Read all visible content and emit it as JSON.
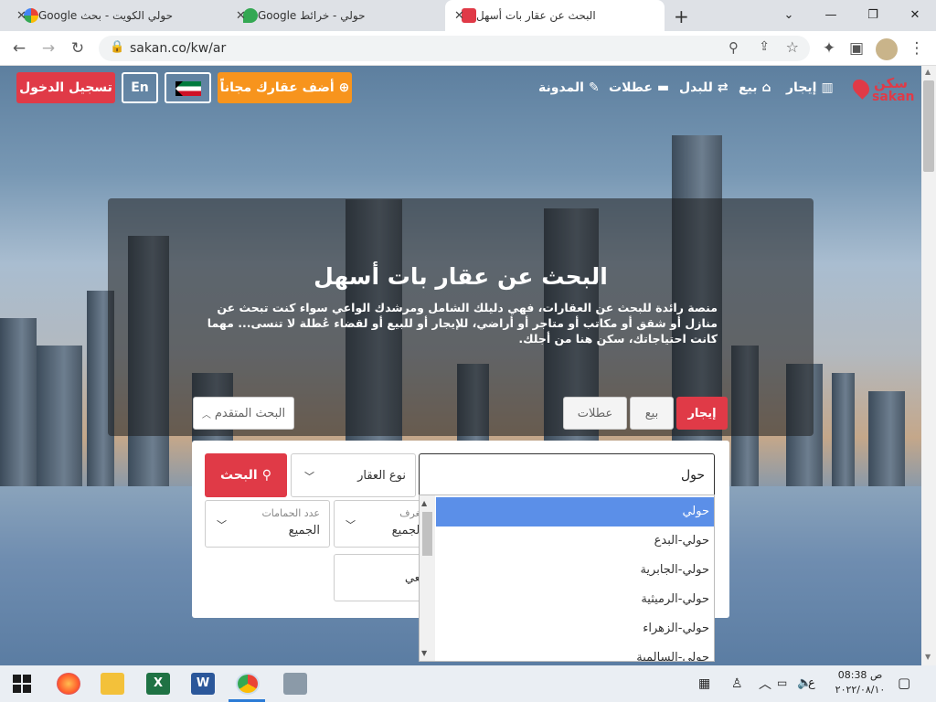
{
  "browser": {
    "tabs": [
      {
        "title": "حولي الكويت - بحث Google",
        "favicon": "google-icon"
      },
      {
        "title": "حولي - خرائط Google",
        "favicon": "maps-icon"
      },
      {
        "title": "البحث عن عقار بات أسهل",
        "favicon": "sakan-icon",
        "active": true
      }
    ],
    "new_tab": "+",
    "url": "sakan.co/kw/ar"
  },
  "site": {
    "logo_ar": "سكن",
    "logo_en": "sakan",
    "nav": [
      {
        "label": "إيجار",
        "icon": "building-icon"
      },
      {
        "label": "بيع",
        "icon": "home-icon"
      },
      {
        "label": "للبدل",
        "icon": "swap-icon"
      },
      {
        "label": "عطلات",
        "icon": "bed-icon"
      },
      {
        "label": "المدونة",
        "icon": "blog-icon"
      }
    ],
    "add_property": "أضف عقارك مجاناً",
    "lang": "En",
    "login": "تسجيل الدخول"
  },
  "hero": {
    "title": "البحث عن عقار بات أسهل",
    "description": "منصة رائدة للبحث عن العقارات، فهي دليلك الشامل ومرشدك الواعي سواء كنت تبحث عن منازل أو شقق أو مكاتب أو متاجر أو أراضي، للإيجار أو للبيع أو لقضاء عُطلة لا تنسى... مهما كانت احتياجاتك، سكن هنا من أجلك."
  },
  "search": {
    "tabs": [
      "إيجار",
      "بيع",
      "عطلات"
    ],
    "advanced": "البحث المتقدم",
    "query": "حول",
    "property_type": "نوع العقار",
    "search_button": "البحث",
    "rooms_label": "عدد الغرف",
    "rooms_value": "الجميع",
    "baths_label": "عدد الحمامات",
    "baths_value": "الجميع",
    "reference": "الرقم المرجعي",
    "suggestions": [
      "حولي",
      "حولي-البدع",
      "حولي-الجابرية",
      "حولي-الرميثية",
      "حولي-الزهراء",
      "حولي-السالمية"
    ]
  },
  "taskbar": {
    "time": "08:38 ص",
    "date": "٢٠٢٢/٠٨/١٠",
    "lang_indicator": "ع"
  }
}
